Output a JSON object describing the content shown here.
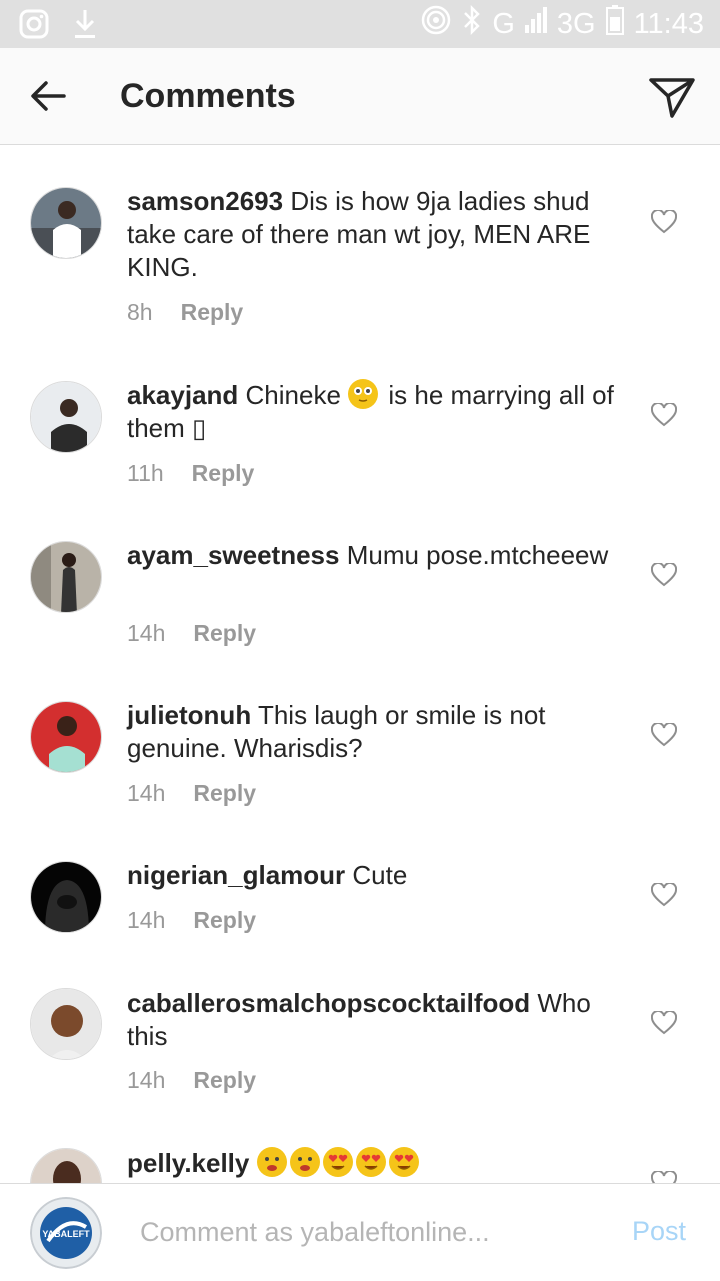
{
  "status_bar": {
    "time": "11:43",
    "network": "G",
    "network_type": "3G",
    "icons": [
      "instagram-icon",
      "download-icon",
      "hotspot-icon",
      "bluetooth-icon",
      "signal-icon",
      "battery-icon"
    ]
  },
  "header": {
    "title": "Comments",
    "back_icon": "arrow-left-icon",
    "send_icon": "direct-send-icon"
  },
  "reply_label": "Reply",
  "comments": [
    {
      "username": "samson2693",
      "text": "Dis is how 9ja ladies shud take care of there man wt joy, MEN ARE KING.",
      "time": "8h",
      "avatar_colors": [
        "#6c7a86",
        "#ffffff"
      ]
    },
    {
      "username": "akayjand",
      "text_before": "Chineke",
      "text_after": "is he marrying all of them ▯",
      "time": "11h",
      "avatar_colors": [
        "#e9ecef",
        "#2b2b2b"
      ]
    },
    {
      "username": "ayam_sweetness",
      "text": "Mumu pose.mtcheeew",
      "time": "14h",
      "avatar_colors": [
        "#b9b3a8",
        "#333333"
      ]
    },
    {
      "username": "julietonuh",
      "text": "This laugh or smile is not genuine. Wharisdis?",
      "time": "14h",
      "avatar_colors": [
        "#d32f2f",
        "#a5e0d2"
      ]
    },
    {
      "username": "nigerian_glamour",
      "text": "Cute",
      "time": "14h",
      "avatar_colors": [
        "#050505",
        "#2a2a2a"
      ]
    },
    {
      "username": "caballerosmalchopscocktailfood",
      "text": "Who this",
      "time": "14h",
      "avatar_colors": [
        "#e8e8e8",
        "#7b4a2c"
      ]
    },
    {
      "username": "pelly.kelly",
      "text": "",
      "time": "",
      "avatar_colors": [
        "#ddd2c9",
        "#4a2c1f"
      ]
    }
  ],
  "composer": {
    "placeholder": "Comment as yabaleftonline...",
    "post_label": "Post",
    "avatar_text": "YABALEFT"
  },
  "colors": {
    "accent": "#a8d5f7",
    "muted": "#999999",
    "text": "#262626",
    "status_bar": "#e0e0e0"
  }
}
